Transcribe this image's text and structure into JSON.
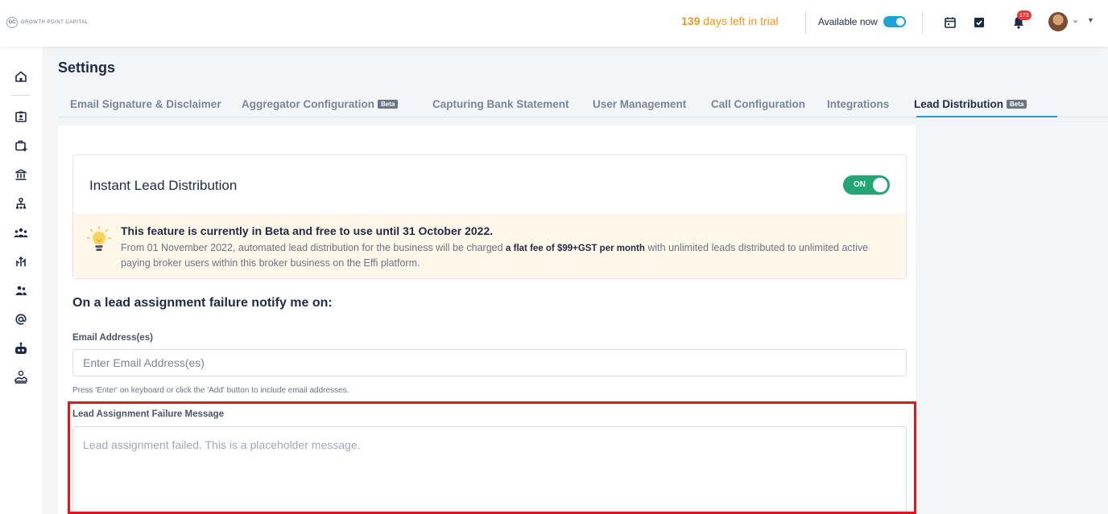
{
  "header": {
    "logo_mark": "GC",
    "logo_text": "GROWTH POINT CAPITAL",
    "trial_days": "139",
    "trial_suffix": " days left in trial",
    "availability_label": "Available now",
    "notification_count": "173"
  },
  "page": {
    "title": "Settings"
  },
  "tabs": [
    {
      "label": "Email Signature & Disclaimer"
    },
    {
      "label": "Aggregator Configuration",
      "badge": "Beta"
    },
    {
      "label": "Capturing Bank Statement"
    },
    {
      "label": "User Management"
    },
    {
      "label": "Call Configuration"
    },
    {
      "label": "Integrations"
    },
    {
      "label": "Lead Distribution",
      "badge": "Beta"
    }
  ],
  "card": {
    "title": "Instant Lead Distribution",
    "toggle_label": "ON"
  },
  "notice": {
    "title": "This feature is currently in Beta and free to use until 31 October 2022.",
    "body_before": "From 01 November 2022, automated lead distribution for the business will be charged ",
    "body_bold": "a flat fee of $99+GST per month",
    "body_after": " with unlimited leads distributed to unlimited active paying broker users within this broker business on the Effi platform."
  },
  "form": {
    "section_title": "On a lead assignment failure notify me on:",
    "email_label": "Email Address(es)",
    "email_placeholder": "Enter Email Address(es)",
    "email_hint": "Press 'Enter' on keyboard or click the 'Add' button to include email addresses.",
    "message_label": "Lead Assignment Failure Message",
    "message_placeholder": "Lead assignment failed. This is a placeholder message."
  },
  "colors": {
    "accent": "#1aa3d9",
    "toggle_on": "#22a676",
    "trial_orange": "#f7931e",
    "notice_bg": "#fff7ea",
    "highlight_red": "#e0161e"
  }
}
